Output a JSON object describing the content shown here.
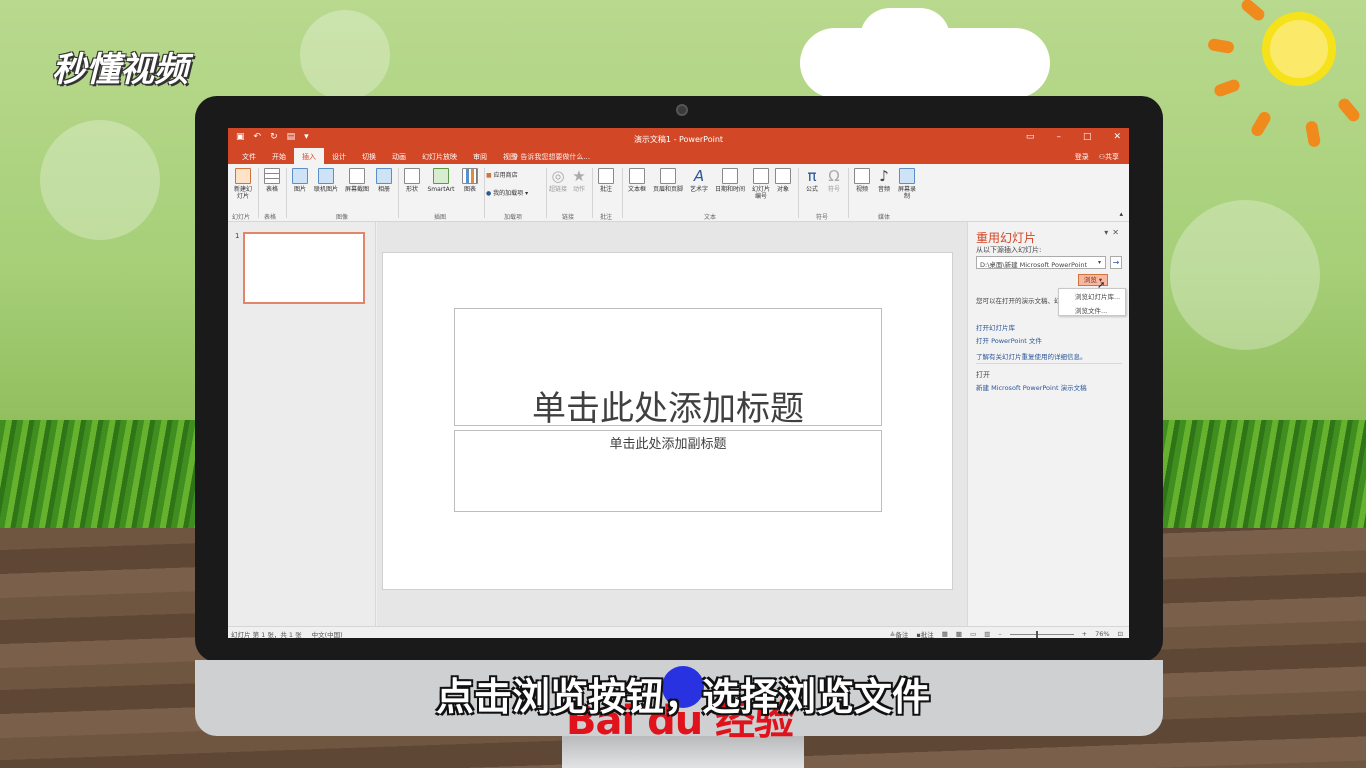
{
  "watermark": {
    "logo": "秒懂视频",
    "subtitle": "点击浏览按钮，选择浏览文件",
    "baidu": "Bai du 经验"
  },
  "app": {
    "title": "演示文稿1 - PowerPoint",
    "qat": [
      "save-icon",
      "undo-icon",
      "redo-icon",
      "present-icon"
    ],
    "tabs": [
      "文件",
      "开始",
      "插入",
      "设计",
      "切换",
      "动画",
      "幻灯片放映",
      "审阅",
      "视图"
    ],
    "active_tab": "插入",
    "tell_me": "告诉我您想要做什么...",
    "signin": "登录",
    "share": "共享",
    "accent": "#d24726"
  },
  "ribbon": {
    "buttons": [
      "新建幻灯片",
      "表格",
      "图片",
      "联机图片",
      "屏幕截图",
      "相册",
      "形状",
      "SmartArt",
      "图表",
      "应用商店",
      "我的加载项",
      "超链接",
      "动作",
      "批注",
      "文本框",
      "页眉和页脚",
      "艺术字",
      "日期和时间",
      "幻灯片编号",
      "对象",
      "公式",
      "符号",
      "视频",
      "音频",
      "屏幕录制"
    ],
    "groups": [
      "幻灯片",
      "表格",
      "图像",
      "插图",
      "加载项",
      "链接",
      "批注",
      "文本",
      "符号",
      "媒体"
    ]
  },
  "thumbs": {
    "num": "1"
  },
  "slide": {
    "title": "单击此处添加标题",
    "subtitle": "单击此处添加副标题"
  },
  "pane": {
    "title": "重用幻灯片",
    "from_label": "从以下源插入幻灯片:",
    "source_value": "D:\\桌面\\新建 Microsoft PowerPoint",
    "browse": "浏览",
    "menu": [
      "浏览幻灯片库...",
      "浏览文件..."
    ],
    "desc": "您可以在打开的演示文稿、幻灯片库或其他 PowerPoint 文件中",
    "links": [
      "打开幻灯片库",
      "打开 PowerPoint 文件",
      "了解有关幻灯片重复使用的详细信息。"
    ],
    "open_heading": "打开",
    "recent": "新建 Microsoft PowerPoint 演示文稿"
  },
  "status": {
    "slide": "幻灯片 第 1 张，共 1 张",
    "lang": "中文(中国)",
    "notes": "备注",
    "comments": "批注",
    "zoom": "76%"
  }
}
